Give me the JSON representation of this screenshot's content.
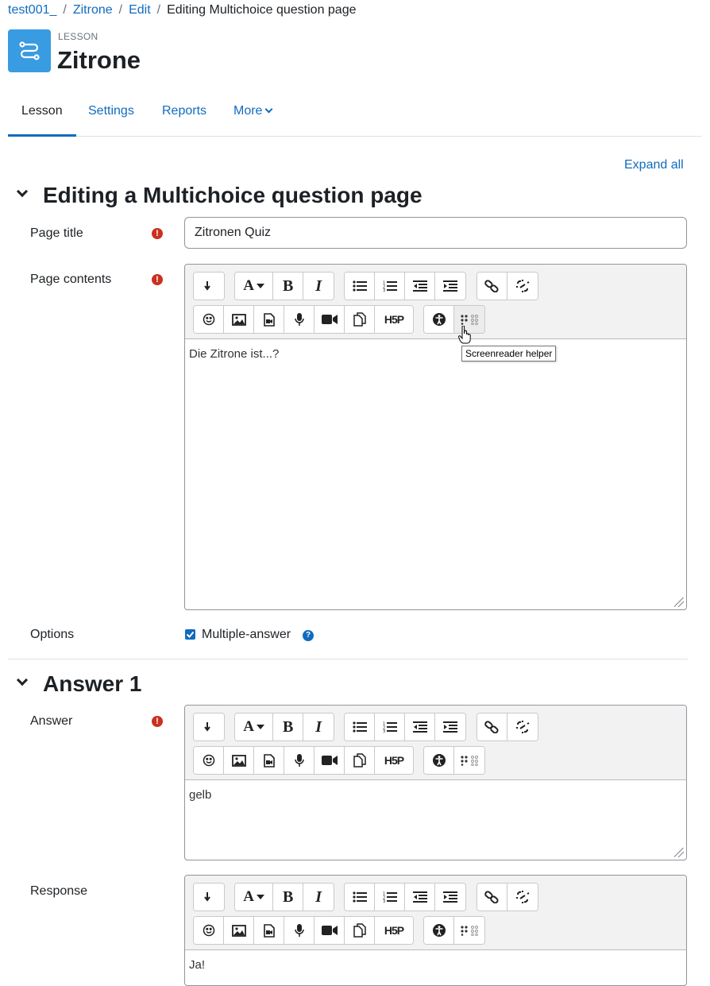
{
  "breadcrumb": {
    "items": [
      "test001_",
      "Zitrone",
      "Edit"
    ],
    "separator": "/",
    "current": "Editing Multichoice question page"
  },
  "header": {
    "type_label": "LESSON",
    "title": "Zitrone",
    "icon": "lesson-icon"
  },
  "nav": {
    "tabs": [
      "Lesson",
      "Settings",
      "Reports",
      "More"
    ],
    "active": "Lesson"
  },
  "expand_all": "Expand all",
  "sections": {
    "main": {
      "title": "Editing a Multichoice question page"
    },
    "answer1": {
      "title": "Answer 1"
    }
  },
  "fields": {
    "page_title": {
      "label": "Page title",
      "value": "Zitronen Quiz"
    },
    "page_contents": {
      "label": "Page contents",
      "value": "Die Zitrone ist...?"
    },
    "options": {
      "label": "Options",
      "checkbox_label": "Multiple-answer",
      "checked": true
    },
    "answer": {
      "label": "Answer",
      "value": "gelb"
    },
    "response": {
      "label": "Response",
      "value": "Ja!"
    }
  },
  "toolbar": {
    "row1": [
      "show-more-icon",
      "font-color-icon",
      "bold-icon",
      "italic-icon",
      "unordered-list-icon",
      "ordered-list-icon",
      "outdent-icon",
      "indent-icon",
      "link-icon",
      "unlink-icon"
    ],
    "row2": [
      "emoji-icon",
      "image-icon",
      "media-icon",
      "record-audio-icon",
      "record-video-icon",
      "manage-files-icon",
      "h5p-icon",
      "accessibility-checker-icon",
      "screenreader-helper-icon"
    ],
    "bold_glyph": "B",
    "italic_glyph": "I",
    "font_glyph": "A",
    "h5p_glyph": "H5P"
  },
  "tooltip": "Screenreader helper",
  "colors": {
    "link": "#0f6cbf",
    "required": "#ca3120",
    "lesson_icon_bg": "#399be2"
  }
}
